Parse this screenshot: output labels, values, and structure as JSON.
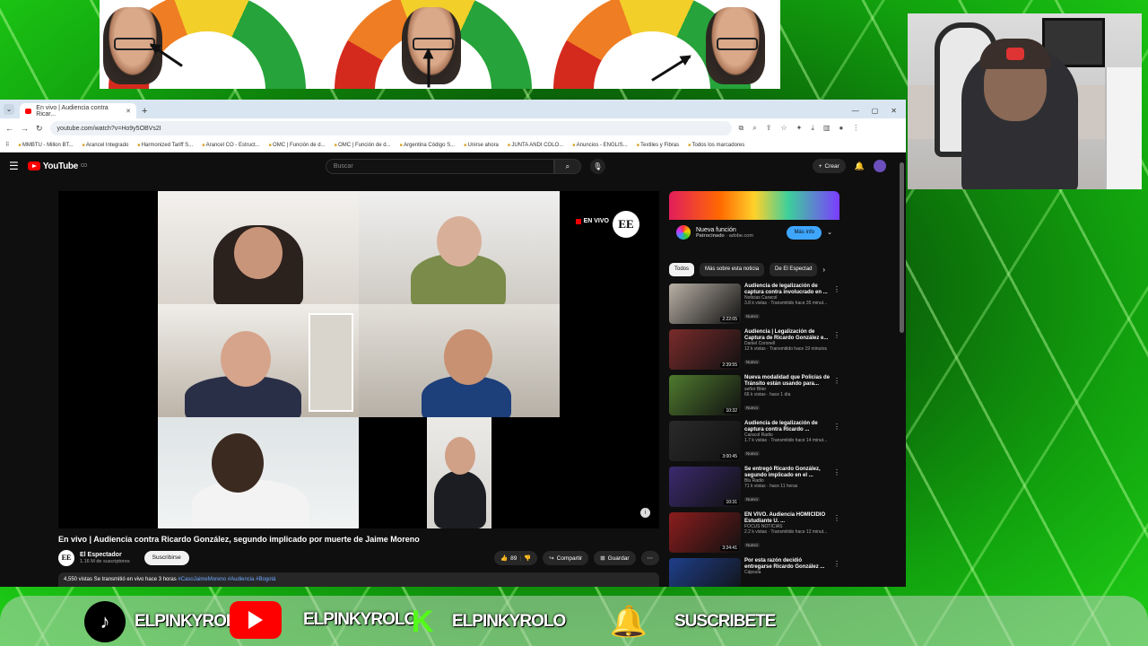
{
  "browser": {
    "tab_title": "En vivo | Audiencia contra Ricar...",
    "url": "youtube.com/watch?v=Ho9y5OBVs2I",
    "bookmarks": [
      "MMBTU - Millon BT...",
      "Arancel Integrado",
      "Harmonized Tariff S...",
      "Arancel CO - Estruct...",
      "OMC | Función de d...",
      "OMC | Función de d...",
      "Argentina Código S...",
      "Unirse ahora",
      "JUNTA ANDI COLO...",
      "Anuncios - ENGLIS...",
      "Textiles y Fibras",
      "Todos los marcadores"
    ]
  },
  "youtube": {
    "logo_text": "YouTube",
    "logo_country": "CO",
    "search_placeholder": "Buscar",
    "create_label": "Crear",
    "live_badge": "EN VIVO",
    "channel_logo": "EE",
    "video_title": "En vivo | Audiencia contra Ricardo González, segundo implicado por muerte de Jaime Moreno",
    "channel_name": "El Espectador",
    "subscribers": "1.16 M de suscriptores",
    "subscribe_label": "Suscribirse",
    "likes": "89",
    "share_label": "Compartir",
    "save_label": "Guardar",
    "views_line": "4,550 vistas  Se transmitió en vivo hace 3 horas",
    "hashtags": "#CasoJaimeMoreno #Audiencia #Bogotá"
  },
  "ad": {
    "title": "Nueva función",
    "sponsored": "Patrocinado",
    "domain": "adobe.com",
    "button": "Más info"
  },
  "chips": [
    "Todos",
    "Más sobre esta noticia",
    "De El Espectad"
  ],
  "recommendations": [
    {
      "title": "Audiencia de legalización de captura contra involucrado en ...",
      "channel": "Noticias Caracol",
      "meta": "3.8 k vistas · Transmitido hace 35 minut...",
      "badge": "Nuevo",
      "duration": "2:22:05",
      "thumb_color": "#b9b1a6"
    },
    {
      "title": "Audiencia | Legalización de Captura de Ricardo González e...",
      "channel": "Daniel Coronell",
      "meta": "12 k vistas · Transmitido hace 19 minutos",
      "badge": "Nuevo",
      "duration": "2:39:55",
      "thumb_color": "#7a2b2b"
    },
    {
      "title": "Nueva modalidad que Policías de Tránsito están usando para...",
      "channel": "señor Biter",
      "meta": "66 k vistas · hace 1 día",
      "badge": "Nuevo",
      "duration": "10:32",
      "thumb_color": "#4f7a2e"
    },
    {
      "title": "Audiencia de legalización de captura contra Ricardo ...",
      "channel": "Caracol Radio",
      "meta": "1.7 k vistas · Transmitido hace 14 minut...",
      "badge": "Nuevo",
      "duration": "3:00:45",
      "thumb_color": "#2a2a2a"
    },
    {
      "title": "Se entregó Ricardo González, segundo implicado en el ...",
      "channel": "Blu Radio",
      "meta": "71 k vistas · hace 11 horas",
      "badge": "Nuevo",
      "duration": "10:31",
      "thumb_color": "#3b2a6e"
    },
    {
      "title": "EN VIVO. Audiencia HOMICIDIO Estudiante U. ...",
      "channel": "FOCUS NOTICIAS",
      "meta": "2.2 k vistas · Transmitido hace 12 minut...",
      "badge": "Nuevo",
      "duration": "3:24:41",
      "thumb_color": "#8c1d1d"
    },
    {
      "title": "Por esta razón decidió entregarse Ricardo González ...",
      "channel": "Cápsula",
      "meta": "",
      "badge": "",
      "duration": "",
      "thumb_color": "#1f3f8a"
    }
  ],
  "footer": {
    "tiktok_handle": "ELPINKYROLO",
    "youtube_handle": "ELPINKYROLO",
    "kick_handle": "ELPINKYROLO",
    "kick_logo": "K",
    "subscribe_text": "SUSCRIBETE"
  },
  "meters": [
    {
      "level": 0.15
    },
    {
      "level": 0.5
    },
    {
      "level": 0.85
    }
  ]
}
